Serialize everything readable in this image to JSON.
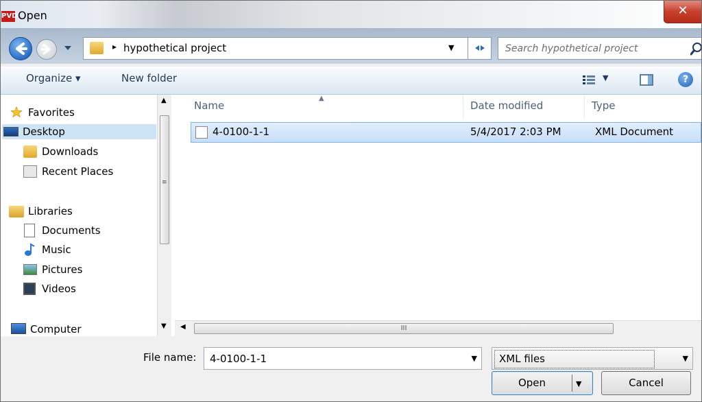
{
  "window": {
    "icon_text": "PVD",
    "title": "Open",
    "close_label": "✕"
  },
  "address_bar": {
    "breadcrumb_arrow": "▸",
    "path": "hypothetical project",
    "search_placeholder": "Search hypothetical project"
  },
  "toolbar": {
    "organize_label": "Organize ▾",
    "new_folder_label": "New folder",
    "help_label": "?"
  },
  "nav": {
    "favorites": "Favorites",
    "desktop": "Desktop",
    "downloads": "Downloads",
    "recent_places": "Recent Places",
    "libraries": "Libraries",
    "documents": "Documents",
    "music": "Music",
    "pictures": "Pictures",
    "videos": "Videos",
    "computer": "Computer"
  },
  "file_list": {
    "columns": [
      "Name",
      "Date modified",
      "Type"
    ],
    "rows": [
      {
        "name": "4-0100-1-1",
        "date": "5/4/2017 2:03 PM",
        "type": "XML Document",
        "selected": true
      }
    ],
    "scroll_grip": "III"
  },
  "bottom": {
    "file_name_label": "File name:",
    "file_name_value": "4-0100-1-1",
    "file_type": "XML files",
    "open_label": "Open",
    "cancel_label": "Cancel"
  },
  "colors": {
    "selection": "#cde3f7",
    "toolbar_text": "#1e395b",
    "close_red": "#c8402c"
  },
  "icons": [
    "app-icon",
    "back-icon",
    "forward-icon",
    "folder-icon",
    "refresh-icon",
    "search-icon",
    "view-icon",
    "preview-pane-icon",
    "help-icon",
    "star-icon",
    "desktop-icon",
    "downloads-icon",
    "recent-places-icon",
    "libraries-icon",
    "documents-icon",
    "music-icon",
    "pictures-icon",
    "videos-icon",
    "computer-icon",
    "xml-file-icon"
  ]
}
